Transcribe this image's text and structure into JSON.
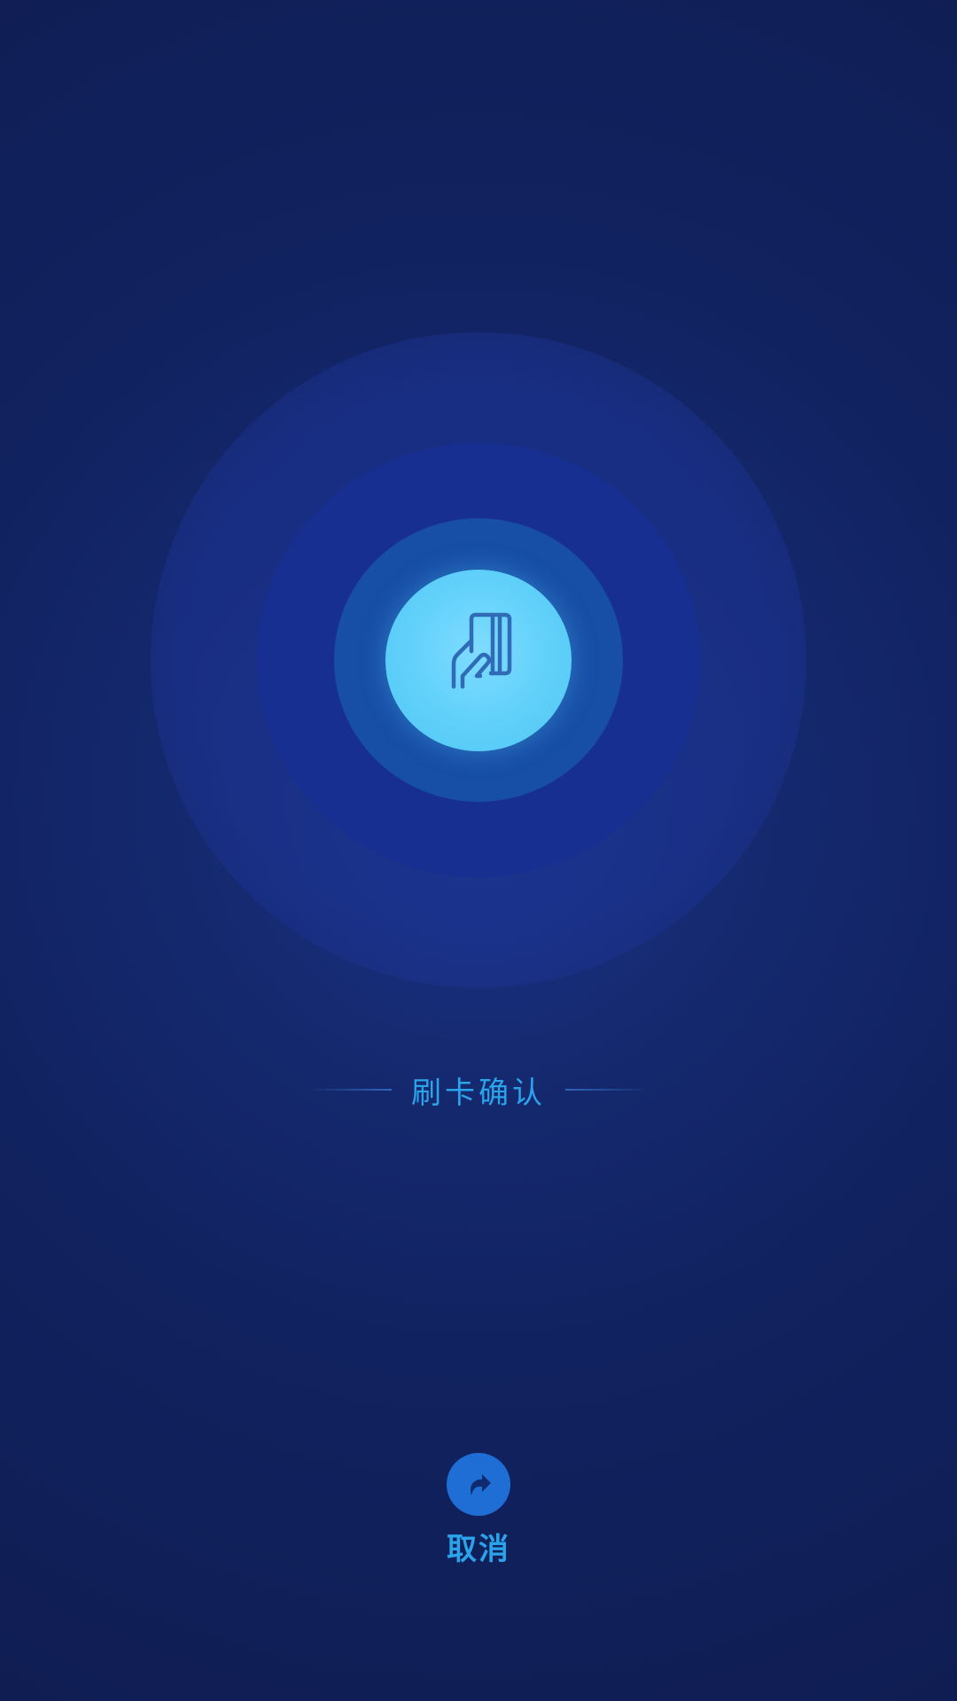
{
  "swipe": {
    "icon": "hand-holding-card-icon",
    "label": "刷卡确认"
  },
  "cancel": {
    "icon": "forward-arrow-icon",
    "label": "取消"
  },
  "colors": {
    "background": "#112260",
    "ring_mid": "#182f92",
    "ring_inner": "#174ea6",
    "core": "#5fd0fa",
    "accent_text": "#2aa3ea",
    "cancel_button": "#1e6ed6"
  }
}
